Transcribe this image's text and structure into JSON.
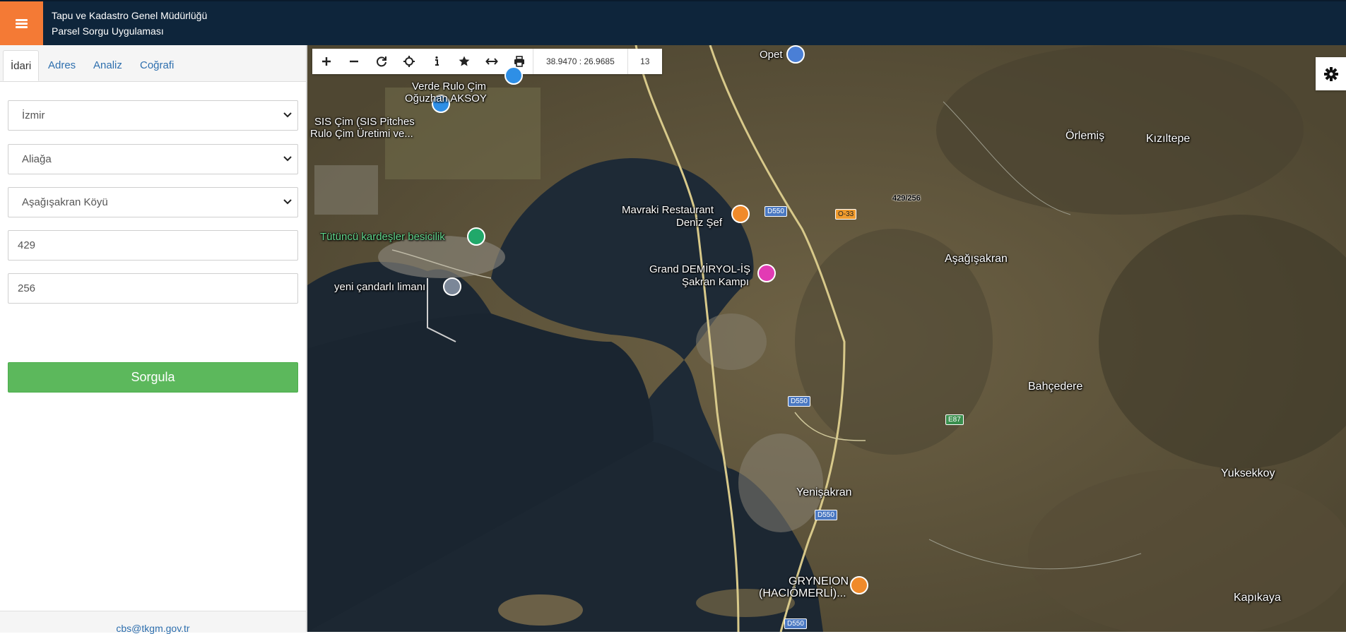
{
  "header": {
    "title_line1": "Tapu ve Kadastro Genel Müdürlüğü",
    "title_line2": "Parsel Sorgu Uygulaması",
    "menu_icon": "hamburger-icon",
    "accent": "#f47a35",
    "bg": "#0e253b"
  },
  "tabs": [
    {
      "label": "İdari",
      "active": true
    },
    {
      "label": "Adres"
    },
    {
      "label": "Analiz"
    },
    {
      "label": "Coğrafi"
    }
  ],
  "form": {
    "province": "İzmir",
    "district": "Aliağa",
    "neighborhood": "Aşağışakran Köyü",
    "block": "429",
    "parcel": "256",
    "query_button": "Sorgula",
    "button_color": "#5cb85c"
  },
  "footer": {
    "email": "cbs@tkgm.gov.tr"
  },
  "map_toolbar": {
    "tools": [
      "zoom-in-icon",
      "zoom-out-icon",
      "refresh-icon",
      "locate-icon",
      "info-icon",
      "star-icon",
      "measure-icon",
      "print-icon"
    ],
    "coords": "38.9470 : 26.9685",
    "zoom": "13"
  },
  "map_labels": {
    "opet": "Opet",
    "verde_1": "Verde Rulo Çim",
    "verde_2": "Oğuzhan AKSOY",
    "sis_1": "SIS Çim (SIS Pitches",
    "sis_2": "Rulo Çim Üretimi ve...",
    "tutuncu": "Tütüncü kardeşler besicilik",
    "liman": "yeni çandarlı limanı",
    "mavraki_1": "Mavraki Restaurant",
    "mavraki_2": "Deniz Şef",
    "grand_1": "Grand DEMİRYOL-İŞ",
    "grand_2": "Şakran Kampı",
    "orlemis": "Örlemiş",
    "kiziltepe": "Kızıltepe",
    "asagisakran": "Aşağışakran",
    "bahcedere": "Bahçedere",
    "yeniskran": "Yenişakran",
    "yuksekkoy": "Yuksekkoy",
    "gryneion_1": "GRYNEION",
    "gryneion_2": "(HACIÖMERLİ)...",
    "kapikaya": "Kapıkaya",
    "parcel": "429/256",
    "road_d550": "D550",
    "road_o33": "O-33",
    "road_e87": "E87"
  }
}
